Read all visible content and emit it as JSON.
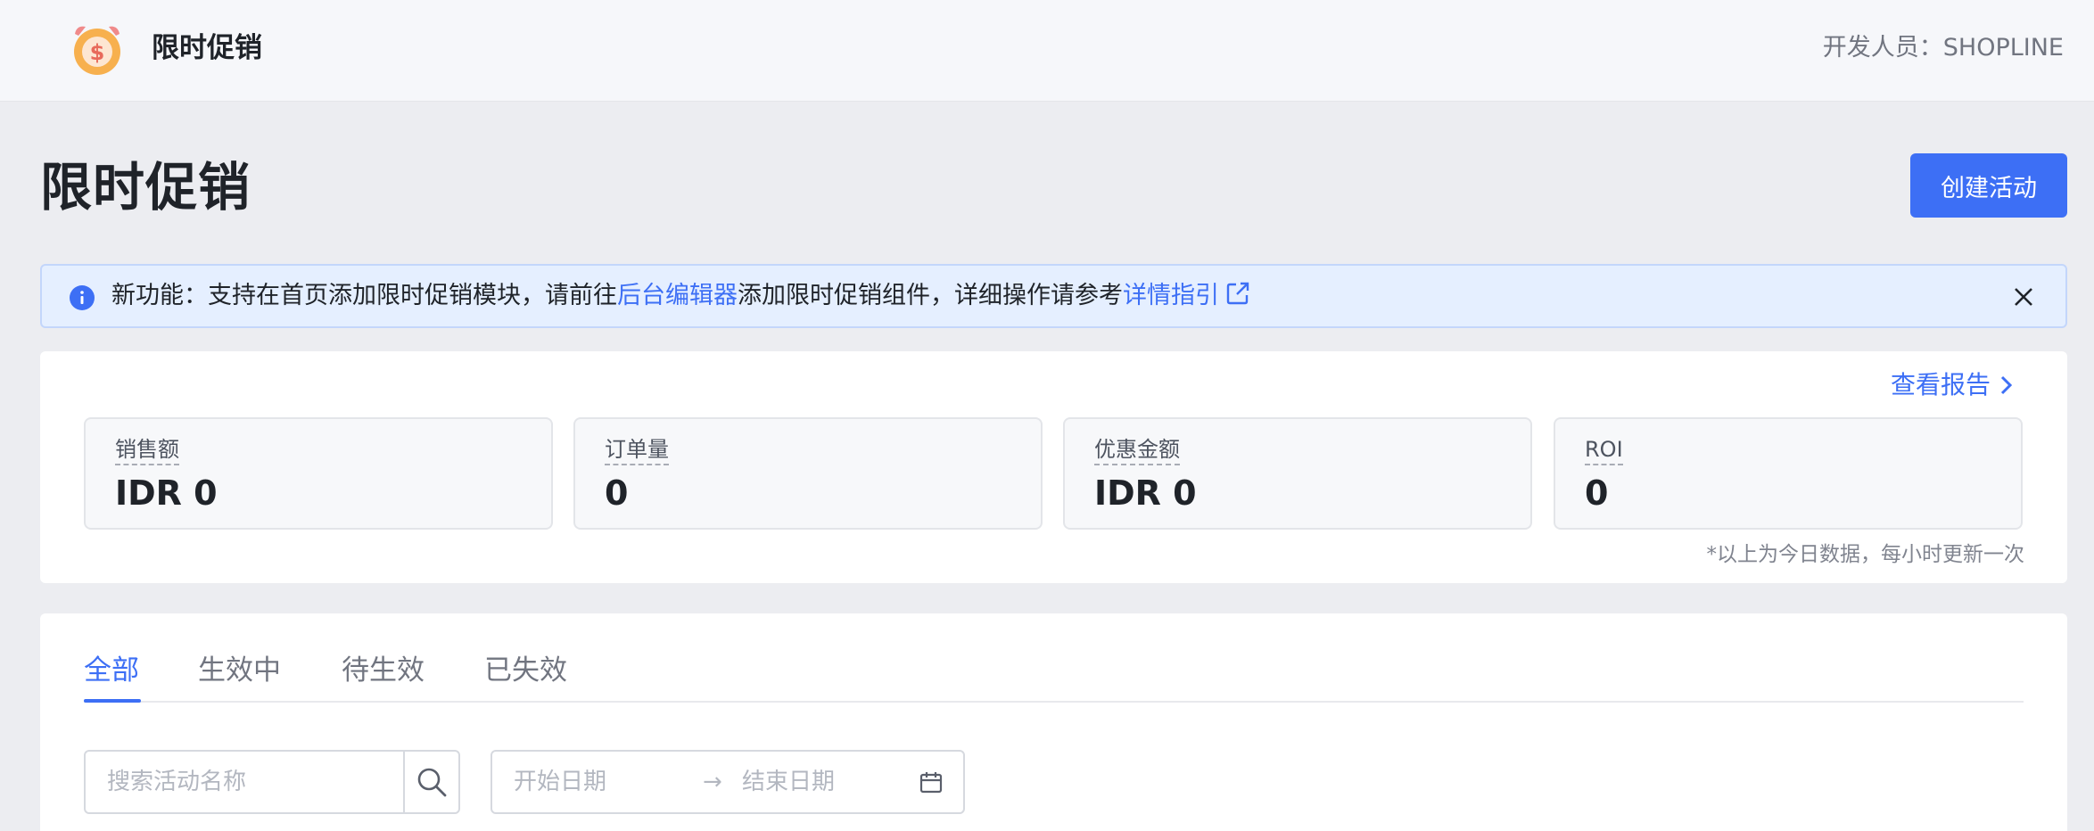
{
  "appbar": {
    "title": "限时促销",
    "developer": "开发人员：SHOPLINE",
    "logo_icon": "alarm-clock-dollar-icon"
  },
  "header": {
    "title": "限时促销",
    "create_button": "创建活动"
  },
  "banner": {
    "prefix": "新功能：支持在首页添加限时促销模块，请前往",
    "link1": "后台编辑器",
    "middle": "添加限时促销组件，详细操作请参考",
    "link2": "详情指引",
    "info_icon": "info-icon",
    "close_icon": "close-icon",
    "external_icon": "external-link-icon"
  },
  "stats": {
    "view_report": "查看报告",
    "items": [
      {
        "label": "销售额",
        "value": "IDR 0"
      },
      {
        "label": "订单量",
        "value": "0"
      },
      {
        "label": "优惠金额",
        "value": "IDR 0"
      },
      {
        "label": "ROI",
        "value": "0"
      }
    ],
    "note": "*以上为今日数据，每小时更新一次"
  },
  "list": {
    "tabs": [
      {
        "label": "全部",
        "active": true
      },
      {
        "label": "生效中",
        "active": false
      },
      {
        "label": "待生效",
        "active": false
      },
      {
        "label": "已失效",
        "active": false
      }
    ],
    "search_placeholder": "搜索活动名称",
    "date_start_placeholder": "开始日期",
    "date_arrow": "→",
    "date_end_placeholder": "结束日期"
  },
  "colors": {
    "accent": "#3d6ff5",
    "banner_bg": "#e5efff",
    "page_bg": "#ecedf1"
  }
}
